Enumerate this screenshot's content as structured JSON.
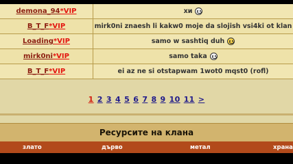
{
  "chat": {
    "rows": [
      {
        "user": "demona_94",
        "vip": "*VIP",
        "msg": "хи",
        "smiley": "grin"
      },
      {
        "user": "B_T_F",
        "vip": "*VIP",
        "msg": "mirk0ni znaesh li kakw0 moje da slojish vsi4ki ot klan",
        "smiley": ""
      },
      {
        "user": "Loading",
        "vip": "*VIP",
        "msg": "samo w sashtiq duh",
        "smiley": "smile"
      },
      {
        "user": "mirk0ni",
        "vip": "*VIP",
        "msg": "samo taka",
        "smiley": "grin"
      },
      {
        "user": "B_T_F",
        "vip": "*VIP",
        "msg": "ei az ne si otstapwam 1wot0 mqst0 (rofl)",
        "smiley": ""
      }
    ]
  },
  "pager": {
    "pages": [
      "1",
      "2",
      "3",
      "4",
      "5",
      "6",
      "7",
      "8",
      "9",
      "10",
      "11",
      ">"
    ],
    "current": "1"
  },
  "resources": {
    "title": "Ресурсите на клана",
    "columns": [
      "злато",
      "дърво",
      "метал",
      "храна"
    ]
  }
}
